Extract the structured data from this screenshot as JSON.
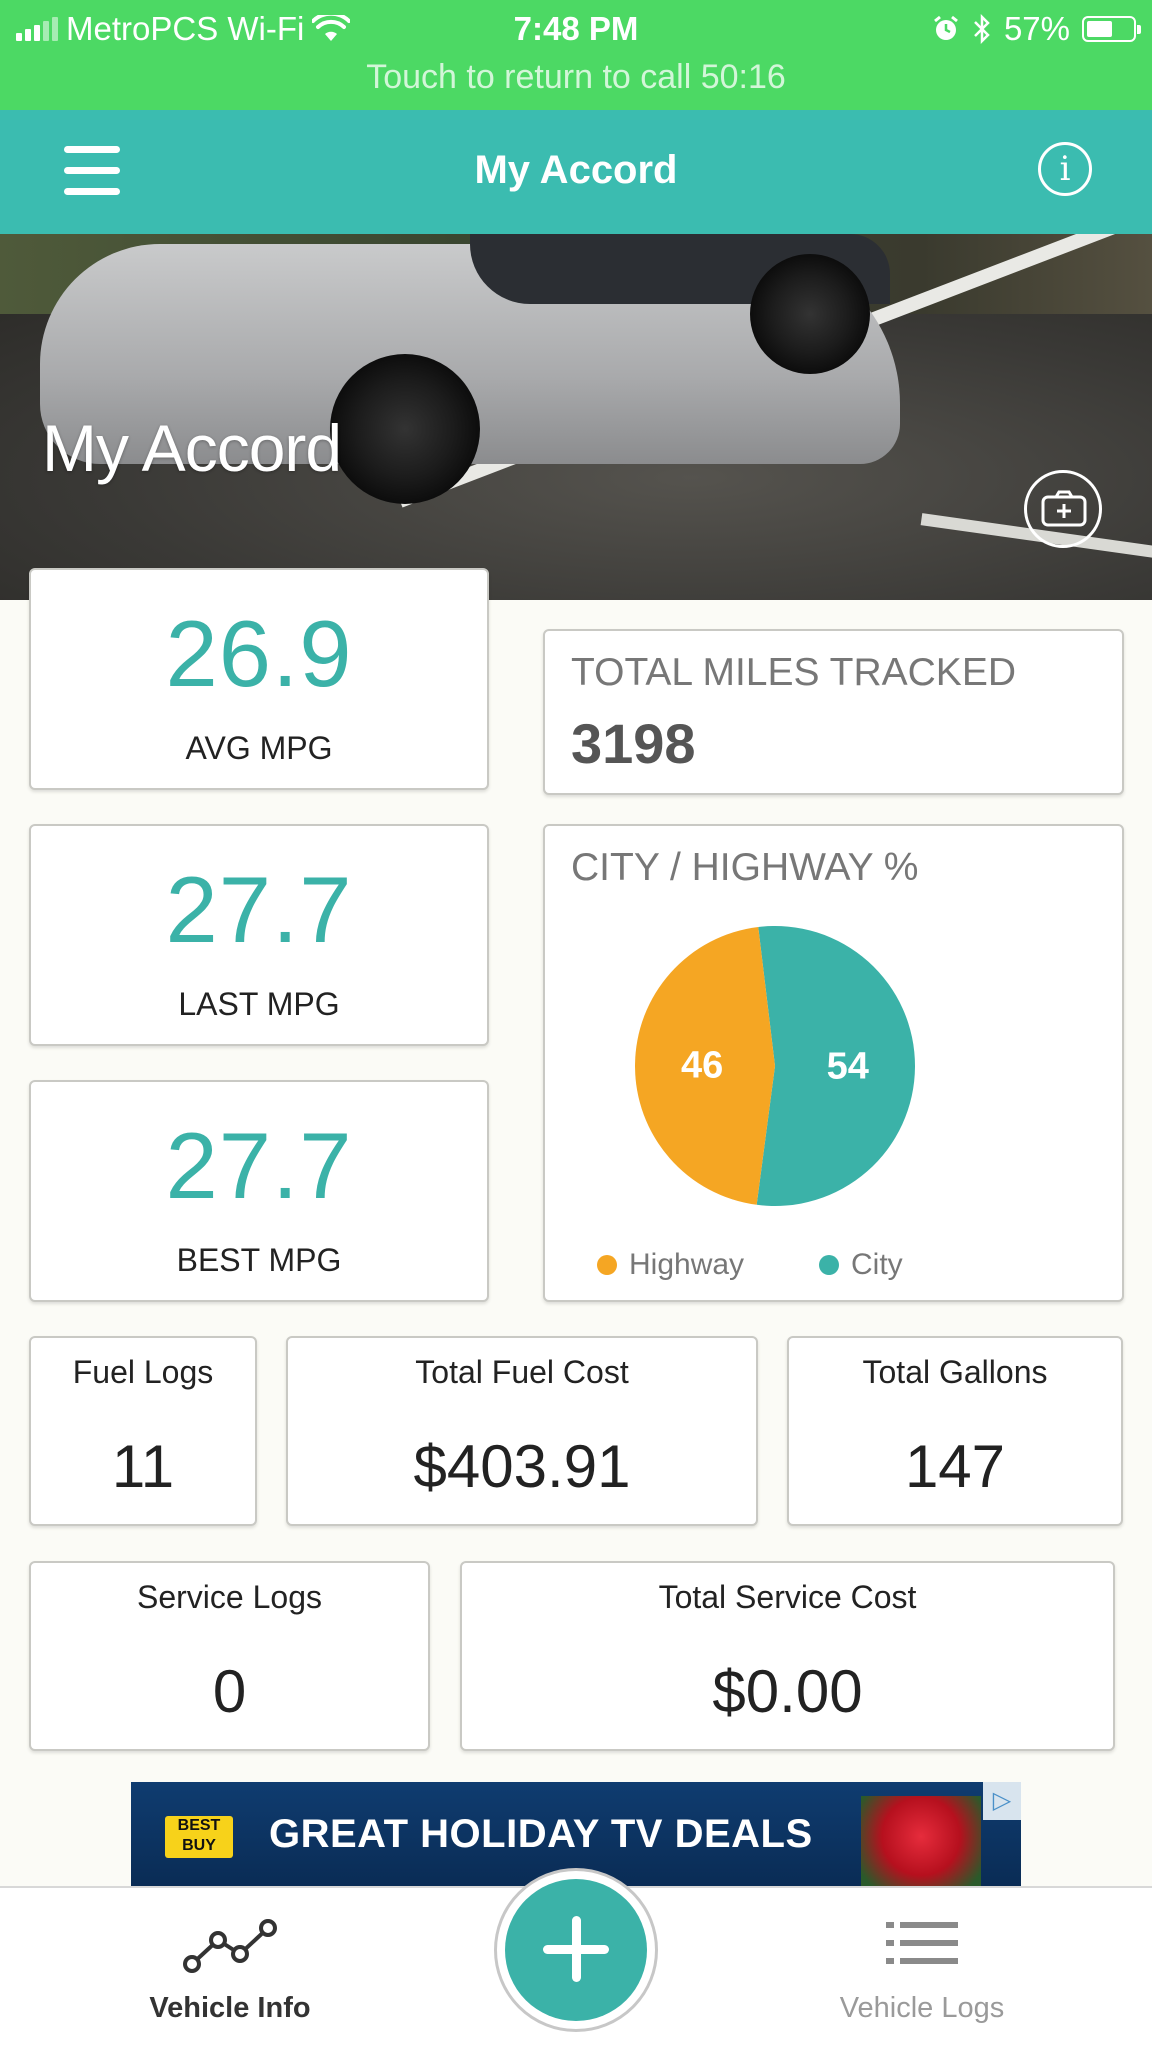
{
  "status_bar": {
    "carrier": "MetroPCS Wi-Fi",
    "time": "7:48 PM",
    "battery_percent": "57%",
    "battery_level": 0.57,
    "call_banner": "Touch to return to call 50:16"
  },
  "nav": {
    "title": "My Accord",
    "menu_icon": "hamburger-icon",
    "info_icon": "info-icon",
    "info_glyph": "i"
  },
  "hero": {
    "vehicle_name": "My Accord",
    "photo_button_icon": "camera-add-icon"
  },
  "mpg": {
    "avg": {
      "value": "26.9",
      "label": "AVG MPG"
    },
    "last": {
      "value": "27.7",
      "label": "LAST MPG"
    },
    "best": {
      "value": "27.7",
      "label": "BEST MPG"
    }
  },
  "miles": {
    "label": "TOTAL MILES TRACKED",
    "value": "3198"
  },
  "city_highway": {
    "label": "CITY / HIGHWAY %",
    "slices": [
      {
        "name": "Highway",
        "value": 46,
        "color": "#f5a623"
      },
      {
        "name": "City",
        "value": 54,
        "color": "#3bb2a8"
      }
    ],
    "legend": {
      "highway": "Highway",
      "city": "City"
    }
  },
  "stats": {
    "fuel_logs": {
      "label": "Fuel Logs",
      "value": "11"
    },
    "total_fuel_cost": {
      "label": "Total Fuel Cost",
      "value": "$403.91"
    },
    "total_gallons": {
      "label": "Total Gallons",
      "value": "147"
    },
    "service_logs": {
      "label": "Service Logs",
      "value": "0"
    },
    "total_service_cost": {
      "label": "Total Service Cost",
      "value": "$0.00"
    }
  },
  "ad": {
    "logo_text": "BEST BUY",
    "text": "GREAT HOLIDAY TV DEALS",
    "adchoices_icon": "adchoices-icon"
  },
  "tabbar": {
    "vehicle_info": "Vehicle Info",
    "vehicle_logs": "Vehicle Logs",
    "add_icon": "plus-icon"
  },
  "colors": {
    "accent": "#3bb2a8",
    "nav_bg": "#3bbcb0",
    "status_bg": "#4cd964",
    "highway": "#f5a623"
  }
}
